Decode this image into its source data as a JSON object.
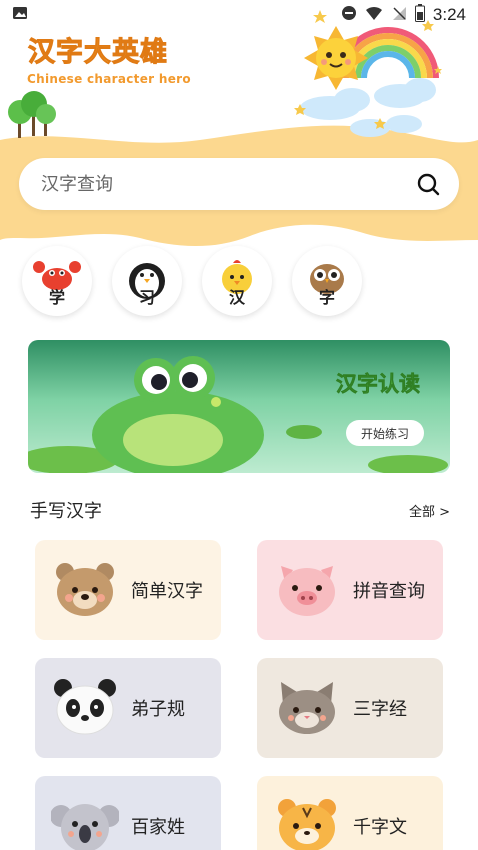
{
  "status_bar": {
    "time": "3:24"
  },
  "header": {
    "title": "汉字大英雄",
    "subtitle": "Chinese character hero"
  },
  "search": {
    "placeholder": "汉字查询"
  },
  "categories": [
    {
      "char": "学",
      "icon": "crab-icon"
    },
    {
      "char": "习",
      "icon": "penguin-icon"
    },
    {
      "char": "汉",
      "icon": "chick-icon"
    },
    {
      "char": "字",
      "icon": "owl-icon"
    }
  ],
  "banner": {
    "title": "汉字认读",
    "button_label": "开始练习"
  },
  "section": {
    "title": "手写汉字",
    "more_label": "全部 >"
  },
  "cards": [
    {
      "label": "简单汉字",
      "bg": "#fdf3e4",
      "icon": "bear-icon"
    },
    {
      "label": "拼音查询",
      "bg": "#fbdfe2",
      "icon": "pig-icon"
    },
    {
      "label": "弟子规",
      "bg": "#e4e4ec",
      "icon": "panda-icon"
    },
    {
      "label": "三字经",
      "bg": "#efe8df",
      "icon": "cat-icon"
    },
    {
      "label": "百家姓",
      "bg": "#e2e4ee",
      "icon": "koala-icon"
    },
    {
      "label": "千字文",
      "bg": "#fdf1dc",
      "icon": "tiger-icon"
    }
  ],
  "colors": {
    "accent_yellow": "#fcd58a",
    "title_orange": "#f5a430",
    "banner_green": "#4aa63a"
  }
}
